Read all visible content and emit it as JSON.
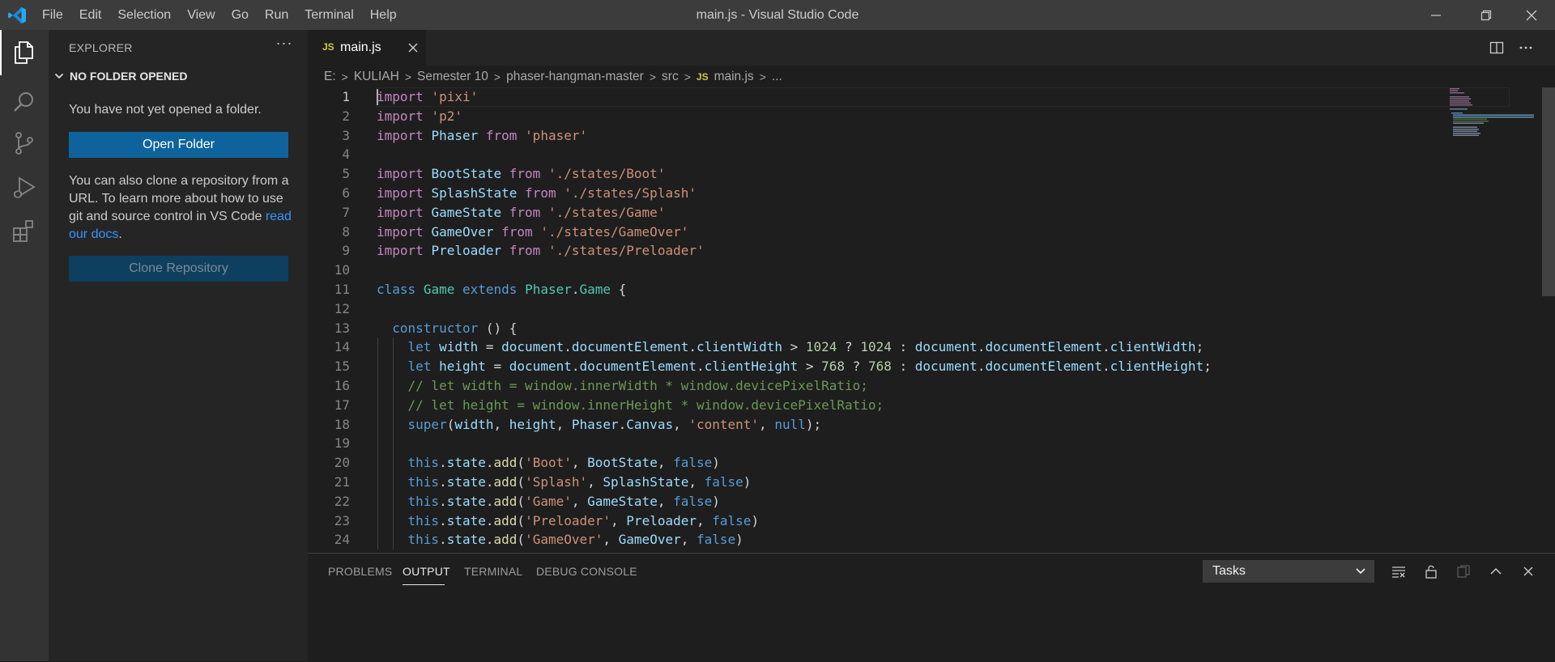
{
  "window": {
    "title": "main.js - Visual Studio Code",
    "menu": [
      "File",
      "Edit",
      "Selection",
      "View",
      "Go",
      "Run",
      "Terminal",
      "Help"
    ]
  },
  "activity_bar": {
    "items": [
      "explorer-icon",
      "search-icon",
      "source-control-icon",
      "run-debug-icon",
      "extensions-icon"
    ],
    "active": "explorer-icon"
  },
  "sidebar": {
    "title": "EXPLORER",
    "more": "···",
    "section_title": "NO FOLDER OPENED",
    "message": "You have not yet opened a folder.",
    "open_folder_label": "Open Folder",
    "clone_text": "You can also clone a repository from a URL. To learn more about how to use git and source control in VS Code",
    "clone_link": "read our docs",
    "clone_end": ".",
    "clone_button_label": "Clone Repository"
  },
  "tabs": [
    {
      "label": "main.js",
      "icon": "JS"
    }
  ],
  "breadcrumb": {
    "parts": [
      "E:",
      "KULIAH",
      "Semester 10",
      "phaser-hangman-master",
      "src"
    ],
    "file_icon": "JS",
    "file": "main.js",
    "ellipsis": "..."
  },
  "editor": {
    "current_line": 1,
    "lines": [
      {
        "n": "1",
        "t": [
          [
            "import",
            "kw"
          ],
          [
            " ",
            "pl"
          ],
          [
            "'pixi'",
            "str"
          ]
        ]
      },
      {
        "n": "2",
        "t": [
          [
            "import",
            "kw"
          ],
          [
            " ",
            "pl"
          ],
          [
            "'p2'",
            "str"
          ]
        ]
      },
      {
        "n": "3",
        "t": [
          [
            "import",
            "kw"
          ],
          [
            " ",
            "pl"
          ],
          [
            "Phaser",
            "var"
          ],
          [
            " ",
            "pl"
          ],
          [
            "from",
            "kw"
          ],
          [
            " ",
            "pl"
          ],
          [
            "'phaser'",
            "str"
          ]
        ]
      },
      {
        "n": "4",
        "t": []
      },
      {
        "n": "5",
        "t": [
          [
            "import",
            "kw"
          ],
          [
            " ",
            "pl"
          ],
          [
            "BootState",
            "var"
          ],
          [
            " ",
            "pl"
          ],
          [
            "from",
            "kw"
          ],
          [
            " ",
            "pl"
          ],
          [
            "'./states/Boot'",
            "str"
          ]
        ]
      },
      {
        "n": "6",
        "t": [
          [
            "import",
            "kw"
          ],
          [
            " ",
            "pl"
          ],
          [
            "SplashState",
            "var"
          ],
          [
            " ",
            "pl"
          ],
          [
            "from",
            "kw"
          ],
          [
            " ",
            "pl"
          ],
          [
            "'./states/Splash'",
            "str"
          ]
        ]
      },
      {
        "n": "7",
        "t": [
          [
            "import",
            "kw"
          ],
          [
            " ",
            "pl"
          ],
          [
            "GameState",
            "var"
          ],
          [
            " ",
            "pl"
          ],
          [
            "from",
            "kw"
          ],
          [
            " ",
            "pl"
          ],
          [
            "'./states/Game'",
            "str"
          ]
        ]
      },
      {
        "n": "8",
        "t": [
          [
            "import",
            "kw"
          ],
          [
            " ",
            "pl"
          ],
          [
            "GameOver",
            "var"
          ],
          [
            " ",
            "pl"
          ],
          [
            "from",
            "kw"
          ],
          [
            " ",
            "pl"
          ],
          [
            "'./states/GameOver'",
            "str"
          ]
        ]
      },
      {
        "n": "9",
        "t": [
          [
            "import",
            "kw"
          ],
          [
            " ",
            "pl"
          ],
          [
            "Preloader",
            "var"
          ],
          [
            " ",
            "pl"
          ],
          [
            "from",
            "kw"
          ],
          [
            " ",
            "pl"
          ],
          [
            "'./states/Preloader'",
            "str"
          ]
        ]
      },
      {
        "n": "10",
        "t": []
      },
      {
        "n": "11",
        "t": [
          [
            "class",
            "st"
          ],
          [
            " ",
            "pl"
          ],
          [
            "Game",
            "cls"
          ],
          [
            " ",
            "pl"
          ],
          [
            "extends",
            "st"
          ],
          [
            " ",
            "pl"
          ],
          [
            "Phaser",
            "cls"
          ],
          [
            ".",
            "pl"
          ],
          [
            "Game",
            "cls"
          ],
          [
            " {",
            "pl"
          ]
        ]
      },
      {
        "n": "12",
        "t": []
      },
      {
        "n": "13",
        "t": [
          [
            "  ",
            "pl"
          ],
          [
            "constructor",
            "st"
          ],
          [
            " () {",
            "pl"
          ]
        ]
      },
      {
        "n": "14",
        "t": [
          [
            "    ",
            "pl"
          ],
          [
            "let",
            "st"
          ],
          [
            " ",
            "pl"
          ],
          [
            "width",
            "var"
          ],
          [
            " = ",
            "pl"
          ],
          [
            "document",
            "var"
          ],
          [
            ".",
            "pl"
          ],
          [
            "documentElement",
            "var"
          ],
          [
            ".",
            "pl"
          ],
          [
            "clientWidth",
            "var"
          ],
          [
            " > ",
            "pl"
          ],
          [
            "1024",
            "num"
          ],
          [
            " ? ",
            "pl"
          ],
          [
            "1024",
            "num"
          ],
          [
            " : ",
            "pl"
          ],
          [
            "document",
            "var"
          ],
          [
            ".",
            "pl"
          ],
          [
            "documentElement",
            "var"
          ],
          [
            ".",
            "pl"
          ],
          [
            "clientWidth",
            "var"
          ],
          [
            ";",
            "pl"
          ]
        ]
      },
      {
        "n": "15",
        "t": [
          [
            "    ",
            "pl"
          ],
          [
            "let",
            "st"
          ],
          [
            " ",
            "pl"
          ],
          [
            "height",
            "var"
          ],
          [
            " = ",
            "pl"
          ],
          [
            "document",
            "var"
          ],
          [
            ".",
            "pl"
          ],
          [
            "documentElement",
            "var"
          ],
          [
            ".",
            "pl"
          ],
          [
            "clientHeight",
            "var"
          ],
          [
            " > ",
            "pl"
          ],
          [
            "768",
            "num"
          ],
          [
            " ? ",
            "pl"
          ],
          [
            "768",
            "num"
          ],
          [
            " : ",
            "pl"
          ],
          [
            "document",
            "var"
          ],
          [
            ".",
            "pl"
          ],
          [
            "documentElement",
            "var"
          ],
          [
            ".",
            "pl"
          ],
          [
            "clientHeight",
            "var"
          ],
          [
            ";",
            "pl"
          ]
        ]
      },
      {
        "n": "16",
        "t": [
          [
            "    ",
            "pl"
          ],
          [
            "// let width = window.innerWidth * window.devicePixelRatio;",
            "cm"
          ]
        ]
      },
      {
        "n": "17",
        "t": [
          [
            "    ",
            "pl"
          ],
          [
            "// let height = window.innerHeight * window.devicePixelRatio;",
            "cm"
          ]
        ]
      },
      {
        "n": "18",
        "t": [
          [
            "    ",
            "pl"
          ],
          [
            "super",
            "st"
          ],
          [
            "(",
            "pl"
          ],
          [
            "width",
            "var"
          ],
          [
            ", ",
            "pl"
          ],
          [
            "height",
            "var"
          ],
          [
            ", ",
            "pl"
          ],
          [
            "Phaser",
            "var"
          ],
          [
            ".",
            "pl"
          ],
          [
            "Canvas",
            "var"
          ],
          [
            ", ",
            "pl"
          ],
          [
            "'content'",
            "str"
          ],
          [
            ", ",
            "pl"
          ],
          [
            "null",
            "st"
          ],
          [
            ");",
            "pl"
          ]
        ]
      },
      {
        "n": "19",
        "t": []
      },
      {
        "n": "20",
        "t": [
          [
            "    ",
            "pl"
          ],
          [
            "this",
            "st"
          ],
          [
            ".",
            "pl"
          ],
          [
            "state",
            "var"
          ],
          [
            ".",
            "pl"
          ],
          [
            "add",
            "fn"
          ],
          [
            "(",
            "pl"
          ],
          [
            "'Boot'",
            "str"
          ],
          [
            ", ",
            "pl"
          ],
          [
            "BootState",
            "var"
          ],
          [
            ", ",
            "pl"
          ],
          [
            "false",
            "st"
          ],
          [
            ")",
            "pl"
          ]
        ]
      },
      {
        "n": "21",
        "t": [
          [
            "    ",
            "pl"
          ],
          [
            "this",
            "st"
          ],
          [
            ".",
            "pl"
          ],
          [
            "state",
            "var"
          ],
          [
            ".",
            "pl"
          ],
          [
            "add",
            "fn"
          ],
          [
            "(",
            "pl"
          ],
          [
            "'Splash'",
            "str"
          ],
          [
            ", ",
            "pl"
          ],
          [
            "SplashState",
            "var"
          ],
          [
            ", ",
            "pl"
          ],
          [
            "false",
            "st"
          ],
          [
            ")",
            "pl"
          ]
        ]
      },
      {
        "n": "22",
        "t": [
          [
            "    ",
            "pl"
          ],
          [
            "this",
            "st"
          ],
          [
            ".",
            "pl"
          ],
          [
            "state",
            "var"
          ],
          [
            ".",
            "pl"
          ],
          [
            "add",
            "fn"
          ],
          [
            "(",
            "pl"
          ],
          [
            "'Game'",
            "str"
          ],
          [
            ", ",
            "pl"
          ],
          [
            "GameState",
            "var"
          ],
          [
            ", ",
            "pl"
          ],
          [
            "false",
            "st"
          ],
          [
            ")",
            "pl"
          ]
        ]
      },
      {
        "n": "23",
        "t": [
          [
            "    ",
            "pl"
          ],
          [
            "this",
            "st"
          ],
          [
            ".",
            "pl"
          ],
          [
            "state",
            "var"
          ],
          [
            ".",
            "pl"
          ],
          [
            "add",
            "fn"
          ],
          [
            "(",
            "pl"
          ],
          [
            "'Preloader'",
            "str"
          ],
          [
            ", ",
            "pl"
          ],
          [
            "Preloader",
            "var"
          ],
          [
            ", ",
            "pl"
          ],
          [
            "false",
            "st"
          ],
          [
            ")",
            "pl"
          ]
        ]
      },
      {
        "n": "24",
        "t": [
          [
            "    ",
            "pl"
          ],
          [
            "this",
            "st"
          ],
          [
            ".",
            "pl"
          ],
          [
            "state",
            "var"
          ],
          [
            ".",
            "pl"
          ],
          [
            "add",
            "fn"
          ],
          [
            "(",
            "pl"
          ],
          [
            "'GameOver'",
            "str"
          ],
          [
            ", ",
            "pl"
          ],
          [
            "GameOver",
            "var"
          ],
          [
            ", ",
            "pl"
          ],
          [
            "false",
            "st"
          ],
          [
            ")",
            "pl"
          ]
        ]
      }
    ]
  },
  "panel": {
    "tabs": [
      "PROBLEMS",
      "OUTPUT",
      "TERMINAL",
      "DEBUG CONSOLE"
    ],
    "active_tab": "OUTPUT",
    "tasks_select": "Tasks"
  },
  "colors": {
    "accent": "#0e639c",
    "link": "#3794ff",
    "keyword": "#c586c0",
    "string": "#ce9178",
    "class": "#4ec9b0",
    "variable": "#9cdcfe",
    "storage": "#569cd6",
    "number": "#b5cea8",
    "function": "#dcdcaa",
    "comment": "#6a9955"
  }
}
